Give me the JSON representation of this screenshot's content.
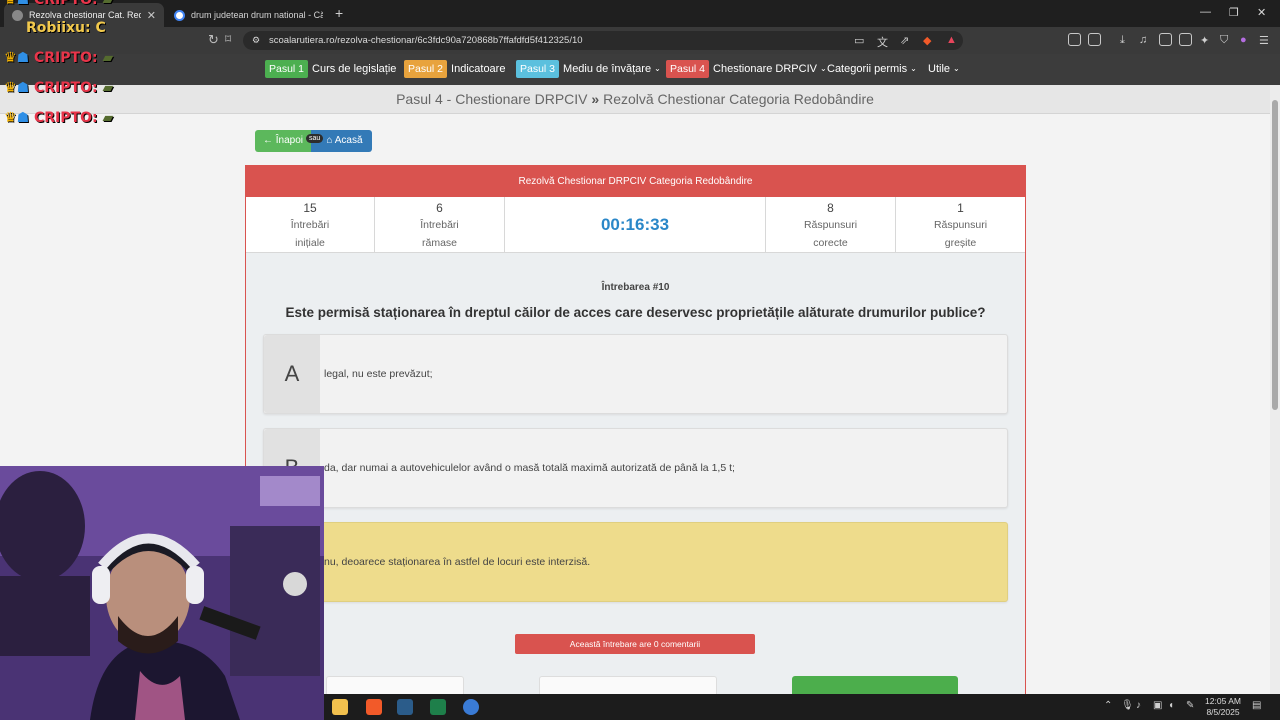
{
  "browser": {
    "tabs": [
      {
        "label": "Rezolva chestionar Cat. Redobândire",
        "active": true
      },
      {
        "label": "drum judetean drum national - Căutare",
        "active": false
      }
    ],
    "url": "scoalarutiera.ro/rezolva-chestionar/6c3fdc90a720868b7ffafdfd5f412325/10",
    "new_tab": "+",
    "window_controls": [
      "—",
      "❐",
      "✕"
    ]
  },
  "overlay": {
    "lines": [
      "CRIPTO:",
      "CRIPTO:",
      "CRIPTO:",
      "CRIPTO:"
    ],
    "user": "Robiixu: C"
  },
  "site_nav": {
    "items": [
      {
        "step": "Pasul 1",
        "label": "Curs de legislație",
        "color": "#4caf50",
        "dropdown": false
      },
      {
        "step": "Pasul 2",
        "label": "Indicatoare",
        "color": "#e8a33d",
        "dropdown": false
      },
      {
        "step": "Pasul 3",
        "label": "Mediu de învățare",
        "color": "#5bc0de",
        "dropdown": true
      },
      {
        "step": "Pasul 4",
        "label": "Chestionare DRPCIV",
        "color": "#d9534f",
        "dropdown": true
      },
      {
        "step": "",
        "label": "Categorii permis",
        "dropdown": true
      },
      {
        "step": "",
        "label": "Utile",
        "dropdown": true
      }
    ]
  },
  "breadcrumb": {
    "part1": "Pasul 4 - Chestionare DRPCIV",
    "separator": "»",
    "part2": "Rezolvă Chestionar Categoria Redobândire"
  },
  "buttons": {
    "back": "Înapoi",
    "or": "sau",
    "home": "Acasă"
  },
  "quiz": {
    "header": "Rezolvă Chestionar DRPCIV Categoria Redobândire",
    "stats": {
      "initial_count": "15",
      "initial_label": "Întrebări inițiale",
      "remaining_count": "6",
      "remaining_label": "Întrebări rămase",
      "timer": "00:16:33",
      "correct_count": "8",
      "correct_label": "Răspunsuri corecte",
      "wrong_count": "1",
      "wrong_label": "Răspunsuri greșite"
    },
    "question_number": "Întrebarea #10",
    "question": "Este permisă staționarea în dreptul căilor de acces care deservesc proprietățile alăturate drumurilor publice?",
    "answers": [
      {
        "letter": "A",
        "text": "legal, nu este prevăzut;",
        "selected": false
      },
      {
        "letter": "B",
        "text": "da, dar numai a autovehiculelor având o masă totală maximă autorizată de până la 1,5 t;",
        "selected": false
      },
      {
        "letter": "C",
        "text": "nu, deoarece staționarea în astfel de locuri este interzisă.",
        "selected": true
      }
    ],
    "comments": "Această întrebare are 0 comentarii"
  },
  "taskbar": {
    "time": "12:05 AM",
    "date": "8/5/2025"
  },
  "colors": {
    "accent_red": "#d9534f",
    "timer_blue": "#2a87c8",
    "selected_yellow": "#eedc8c"
  }
}
